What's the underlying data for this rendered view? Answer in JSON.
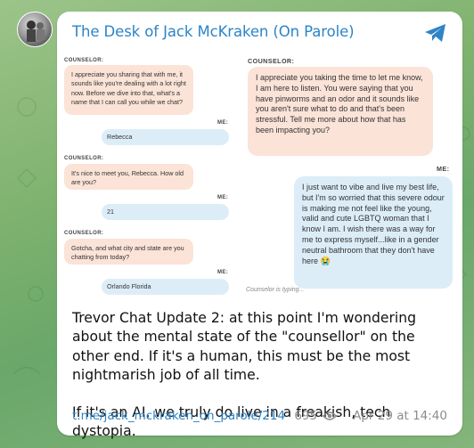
{
  "channel": {
    "title": "The Desk of Jack McKraken (On Parole)"
  },
  "chat_left": [
    {
      "sender": "COUNSELOR:",
      "side": "in",
      "text": "I appreciate you sharing that with me, it sounds like you're dealing with a lot right now. Before we dive into that, what's a name that I can call you while we chat?"
    },
    {
      "sender": "ME:",
      "side": "out",
      "text": "Rebecca"
    },
    {
      "sender": "COUNSELOR:",
      "side": "in",
      "text": "It's nice to meet you, Rebecca. How old are you?"
    },
    {
      "sender": "ME:",
      "side": "out",
      "text": "21"
    },
    {
      "sender": "COUNSELOR:",
      "side": "in",
      "text": "Gotcha, and what city and state are you chatting from today?"
    },
    {
      "sender": "ME:",
      "side": "out",
      "text": "Orlando Florida"
    }
  ],
  "chat_right": [
    {
      "sender": "COUNSELOR:",
      "side": "in",
      "text": "I appreciate you taking the time to let me know, I am here to listen. You were saying that you have pinworms and an odor and it sounds like you aren't sure what to do and that's been stressful. Tell me more about how that has been impacting you?"
    },
    {
      "sender": "ME:",
      "side": "out",
      "text": "I just want to vibe and live my best life, but I'm so worried that this severe odour is making me not feel like the young, valid and cute LGBTQ woman that I know I am. I wish there was a way for me to express myself...like in a gender neutral bathroom that they don't have here 😭"
    }
  ],
  "typing_status": "Counselor is typing...",
  "post": {
    "paragraph1": "Trevor Chat Update 2: at this point I'm wondering about the mental state of the \"counsellor\" on the other end. If it's a human, this must be the most nightmarish job of all time.",
    "paragraph2": "If it's an AI, we truly do live in a freakish, tech dystopia.",
    "link": "t.me/jack_mckraken_on_parole/214",
    "views": "695",
    "date": "Apr 29 at 14:40"
  },
  "icons": {
    "channel_badge": "telegram-icon",
    "views": "eye-icon"
  }
}
